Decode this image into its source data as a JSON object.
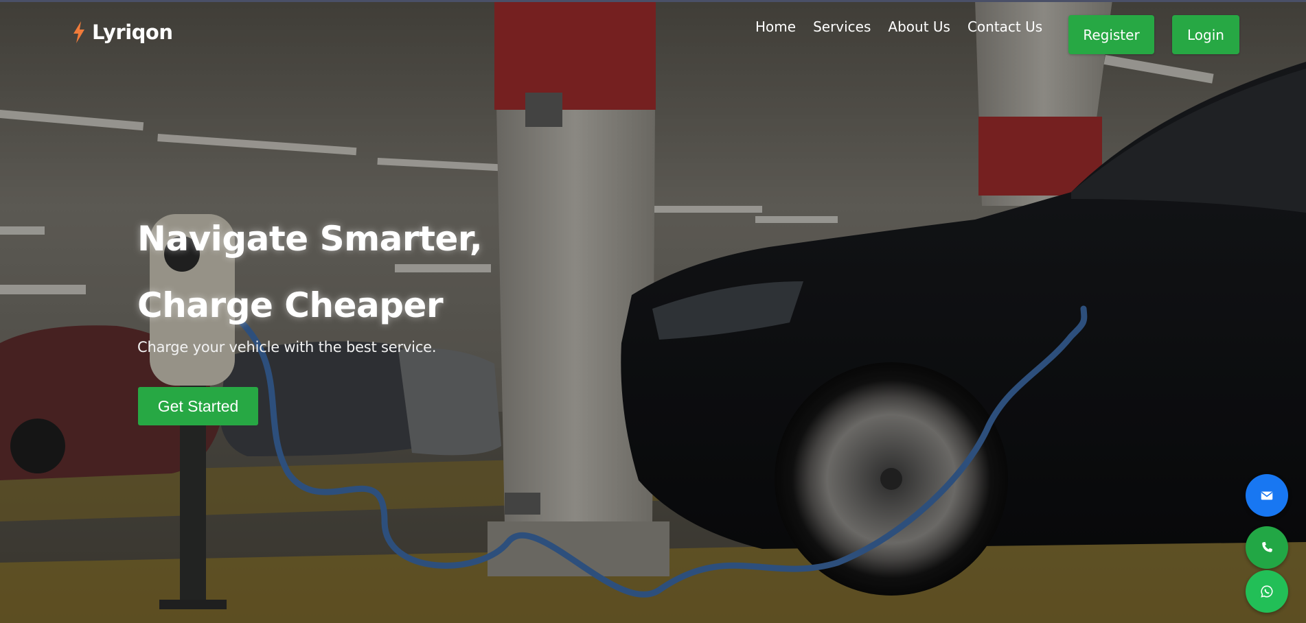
{
  "brand": {
    "name": "Lyriqon",
    "icon": "lightning-bolt-icon",
    "icon_color": "#f07b3a"
  },
  "nav": {
    "links": [
      "Home",
      "Services",
      "About Us",
      "Contact Us"
    ],
    "register_label": "Register",
    "login_label": "Login"
  },
  "hero": {
    "headline_line1": "Navigate Smarter,",
    "headline_line2": "Charge Cheaper",
    "subtitle": "Charge your vehicle with the best service.",
    "cta_label": "Get Started",
    "background": "photo of a black electric car charging in a parking garage"
  },
  "floating_actions": [
    {
      "icon": "email-icon",
      "color": "#1877f2"
    },
    {
      "icon": "phone-icon",
      "color": "#22a745"
    },
    {
      "icon": "whatsapp-icon",
      "color": "#22bf57"
    }
  ],
  "colors": {
    "accent_green": "#27a844",
    "text": "#ffffff"
  }
}
